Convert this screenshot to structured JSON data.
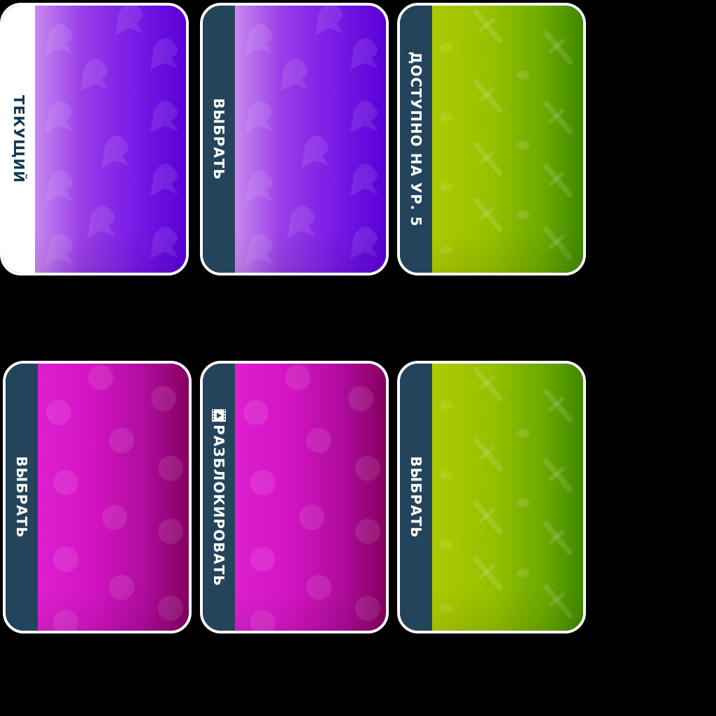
{
  "cards": [
    {
      "label": "ТЕКУЩИЙ",
      "theme": "purple",
      "state": "current",
      "pattern_icon": "ghost-icon"
    },
    {
      "label": "ВЫБРАТЬ",
      "theme": "purple",
      "state": "select",
      "pattern_icon": "ghost-icon"
    },
    {
      "label": "ДОСТУПНО НА УР. 5",
      "theme": "green",
      "state": "locked-level",
      "pattern_icon": "sword-leaf-icon"
    },
    {
      "label": "ВЫБРАТЬ",
      "theme": "magenta",
      "state": "select",
      "pattern_icon": "skull-icon"
    },
    {
      "label": "РАЗБЛОКИРОВАТЬ",
      "theme": "magenta",
      "state": "unlock-video",
      "pattern_icon": "skull-icon",
      "label_icon": "video-icon"
    },
    {
      "label": "ВЫБРАТЬ",
      "theme": "green",
      "state": "select",
      "pattern_icon": "sword-leaf-icon"
    }
  ],
  "colors": {
    "strip": "#23445a",
    "strip_current": "#ffffff",
    "current_text": "#12384e",
    "border": "#ffffff",
    "background": "#000000"
  }
}
